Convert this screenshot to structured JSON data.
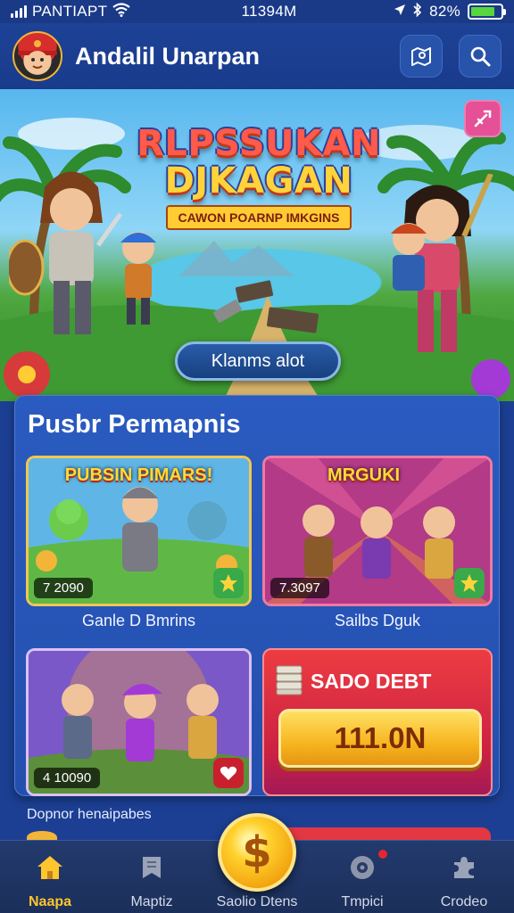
{
  "status_bar": {
    "carrier": "PANTIAPT",
    "time": "11394M",
    "battery_percent": "82%",
    "battery_level": 0.82
  },
  "header": {
    "app_title": "Andalil Unarpan",
    "avatar_icon": "player-avatar",
    "map_button_icon": "map-icon",
    "search_button_icon": "search-icon"
  },
  "hero": {
    "title_line1": "RLPSSUKAN",
    "title_line2": "DJKAGAN",
    "subtitle": "CAWON POARNP IMKGINS",
    "cta_label": "Klanms alot",
    "corner_icon": "sword-icon"
  },
  "promo": {
    "title": "Pusbr Permapnis",
    "cards": [
      {
        "banner": "PUBSIN PIMARS!",
        "value": "7 2090",
        "caption": "Ganle D Bmrins",
        "badge_icon": "star-icon"
      },
      {
        "banner": "MRGUKI",
        "value": "7.3097",
        "caption": "Sailbs Dguk",
        "badge_icon": "star-icon"
      },
      {
        "value": "4 10090",
        "badge_icon": "heart-icon"
      }
    ],
    "offer": {
      "title": "SADO DEBT",
      "button_label": "111.0N",
      "icon": "cash-stack-icon"
    }
  },
  "footer_note": "Dopnor henaipabes",
  "bottom_nav": {
    "items": [
      {
        "label": "Naapa",
        "icon": "home-icon",
        "active": true
      },
      {
        "label": "Maptiz",
        "icon": "map-icon",
        "active": false
      },
      {
        "label": "Saolio Dtens",
        "icon": "coin-icon",
        "active": false
      },
      {
        "label": "Tmpici",
        "icon": "settings-icon",
        "active": false
      },
      {
        "label": "Crodeo",
        "icon": "puzzle-icon",
        "active": false
      }
    ],
    "fab_symbol": "$"
  },
  "colors": {
    "background": "#1c3f93",
    "accent_gold": "#ffc52e",
    "offer_red": "#e33843",
    "panel_blue": "#2a5bc0"
  }
}
